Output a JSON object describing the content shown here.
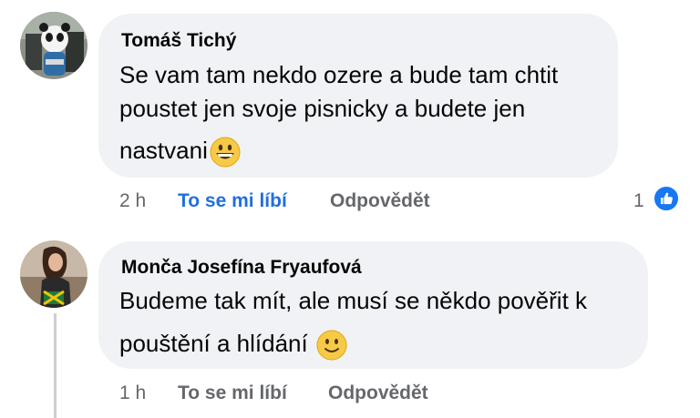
{
  "comments": [
    {
      "author": "Tomáš Tichý",
      "lines": [
        "Se vam tam nekdo ozere a bude tam chtit",
        "poustet jen svoje pisnicky a budete jen",
        "nastvani"
      ],
      "emoji": "grinning-face",
      "time": "2 h",
      "like_label": "To se mi líbí",
      "like_active": true,
      "reply_label": "Odpovědět",
      "reactions": "1",
      "reaction_icon": "thumbs-up-icon"
    },
    {
      "author": "Monča Josefína Fryaufová",
      "lines": [
        "Budeme tak mít, ale musí se někdo pověřit k",
        "pouštění a hlídání"
      ],
      "emoji": "slightly-smiling-face",
      "time": "1 h",
      "like_label": "To se mi líbí",
      "like_active": false,
      "reply_label": "Odpovědět"
    }
  ],
  "colors": {
    "bubble": "#f0f2f5",
    "meta": "#65676b",
    "liked": "#216fdb",
    "like_badge": "#1877f2"
  }
}
